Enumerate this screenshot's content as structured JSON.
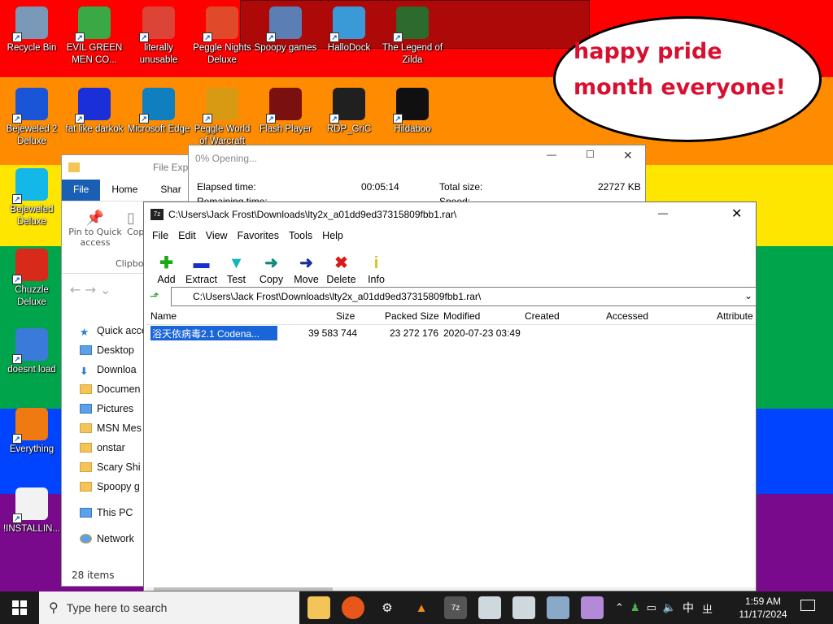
{
  "desktop": {
    "colors": [
      "#ff0000",
      "#ff8c00",
      "#ffe600",
      "#00a44a",
      "#0044ff",
      "#7a0a8c"
    ],
    "icons": [
      {
        "label": "Recycle Bin",
        "icon": "recycle-bin-icon",
        "color": "#7a98b8"
      },
      {
        "label": "EVIL GREEN MEN CO...",
        "icon": "msn-people-icon",
        "color": "#3aa845"
      },
      {
        "label": "literally unusable",
        "icon": "chrome-icon",
        "color": "#db4437"
      },
      {
        "label": "Peggle Nights Deluxe",
        "icon": "peggle-nights-icon",
        "color": "#e04a2a"
      },
      {
        "label": "Spoopy games",
        "icon": "computers-icon",
        "color": "#5b7fb5"
      },
      {
        "label": "HalloDock",
        "icon": "hallodock-icon",
        "color": "#3a9ad8"
      },
      {
        "label": "The Legend of Zilda",
        "icon": "zilda-character-icon",
        "color": "#2d6a2d"
      },
      {
        "label": "Bejeweled 2 Deluxe",
        "icon": "bejeweled2-icon",
        "color": "#1a55d8"
      },
      {
        "label": "fat like darkok",
        "icon": "mpl-icon",
        "color": "#1a2fd8"
      },
      {
        "label": "Microsoft Edge",
        "icon": "edge-icon",
        "color": "#0f7fc0"
      },
      {
        "label": "Peggle World of Warcraft",
        "icon": "peggle-world-icon",
        "color": "#d89a12"
      },
      {
        "label": "Flash Player",
        "icon": "flash-icon",
        "color": "#7a1010"
      },
      {
        "label": "RDP_GriC",
        "icon": "rdp-icon",
        "color": "#202020"
      },
      {
        "label": "Hildaboo",
        "icon": "yashma-icon",
        "color": "#101010"
      },
      {
        "label": "Bejeweled Deluxe",
        "icon": "bejeweled-icon",
        "color": "#14b8e8"
      },
      {
        "label": "Chuzzle Deluxe",
        "icon": "chuzzle-icon",
        "color": "#d82a1a"
      },
      {
        "label": "doesnt load",
        "icon": "thunderbird-icon",
        "color": "#3a7ad8"
      },
      {
        "label": "Everything",
        "icon": "everything-search-icon",
        "color": "#f07a12"
      },
      {
        "label": "!INSTALLIN...",
        "icon": "text-file-icon",
        "color": "#f2f2f2"
      }
    ]
  },
  "bubble": {
    "text": "happy pride month everyone!"
  },
  "progress_dialog": {
    "title": "0% Opening...",
    "elapsed_label": "Elapsed time:",
    "elapsed_value": "00:05:14",
    "remaining_label": "Remaining time:",
    "total_label": "Total size:",
    "total_value": "22727 KB",
    "speed_label": "Speed:"
  },
  "explorer": {
    "title": "File Explo",
    "tabs": [
      "File",
      "Home",
      "Shar"
    ],
    "ribbon": {
      "pin_label": "Pin to Quick access",
      "copy_label": "Cop",
      "group_label": "Clipbo"
    },
    "tree": [
      "Quick acce",
      "Desktop",
      "Downloa",
      "Documen",
      "Pictures",
      "MSN Mes",
      "onstar",
      "Scary Shi",
      "Spoopy g",
      "This PC",
      "Network"
    ],
    "status": "28 items"
  },
  "zip": {
    "title": "C:\\Users\\Jack Frost\\Downloads\\lty2x_a01dd9ed37315809fbb1.rar\\",
    "menu": [
      "File",
      "Edit",
      "View",
      "Favorites",
      "Tools",
      "Help"
    ],
    "toolbar": [
      {
        "label": "Add",
        "glyph": "✚",
        "color": "#1aa81a",
        "icon": "add-icon"
      },
      {
        "label": "Extract",
        "glyph": "▬",
        "color": "#1a2fd0",
        "icon": "extract-icon"
      },
      {
        "label": "Test",
        "glyph": "▼",
        "color": "#0fb8b0",
        "icon": "test-icon"
      },
      {
        "label": "Copy",
        "glyph": "➜",
        "color": "#0f8a7a",
        "icon": "copy-icon"
      },
      {
        "label": "Move",
        "glyph": "➜",
        "color": "#1a2f9a",
        "icon": "move-icon"
      },
      {
        "label": "Delete",
        "glyph": "✖",
        "color": "#d81a1a",
        "icon": "delete-icon"
      },
      {
        "label": "Info",
        "glyph": "i",
        "color": "#d8c012",
        "icon": "info-icon"
      }
    ],
    "address": "C:\\Users\\Jack Frost\\Downloads\\lty2x_a01dd9ed37315809fbb1.rar\\",
    "columns": [
      "Name",
      "Size",
      "Packed Size",
      "Modified",
      "Created",
      "Accessed",
      "Attribute"
    ],
    "row": {
      "name": "浴天依病毒2.1 Codena...",
      "size": "39 583 744",
      "packed": "23 272 176",
      "modified": "2020-07-23 03:49"
    }
  },
  "taskbar": {
    "search_placeholder": "Type here to search",
    "time": "1:59 AM",
    "date": "11/17/2024",
    "ime": "中",
    "ime2": "ㄓ"
  }
}
